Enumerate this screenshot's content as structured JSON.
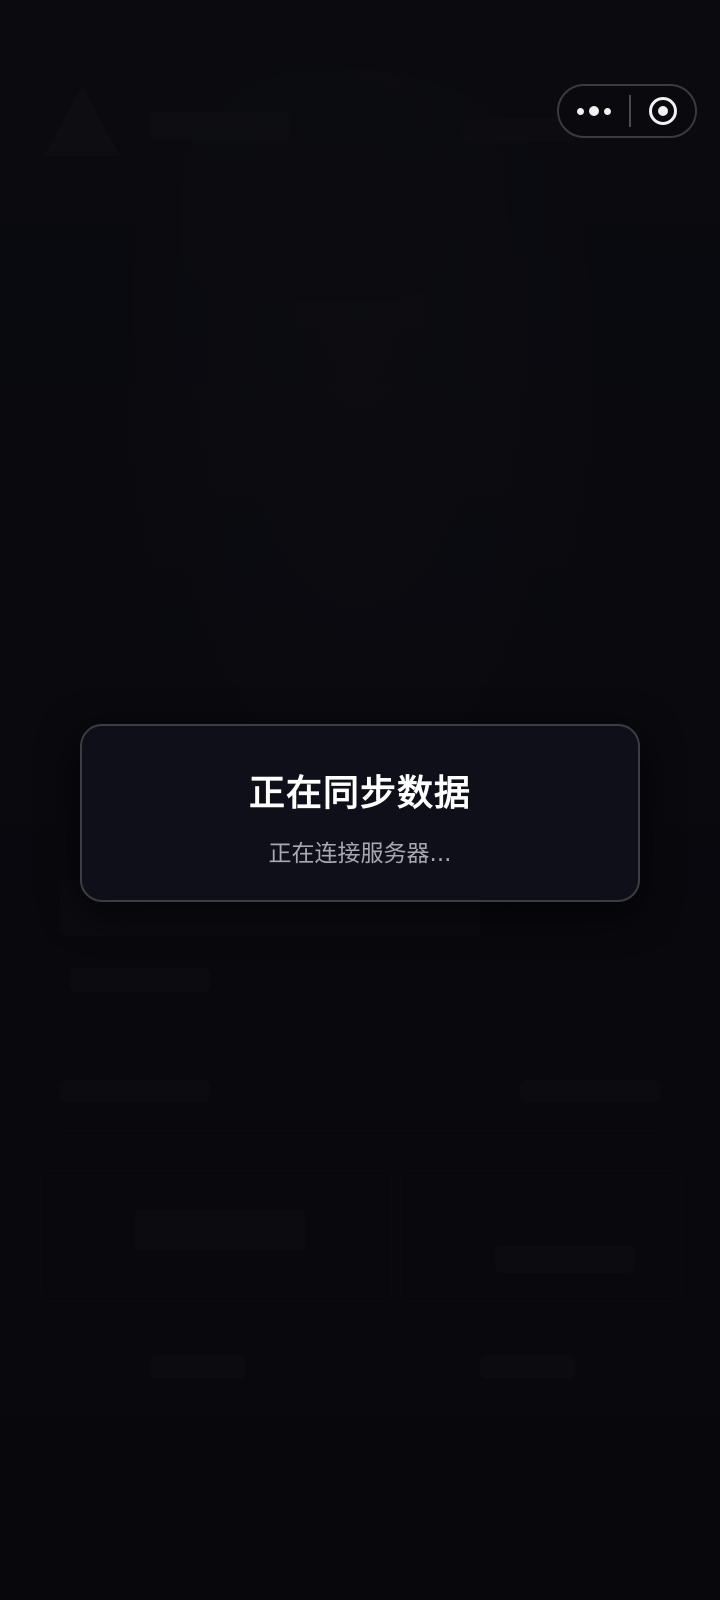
{
  "capsule": {
    "more_icon": "more-dots-icon",
    "close_icon": "target-circle-icon"
  },
  "dialog": {
    "title": "正在同步数据",
    "subtitle": "正在连接服务器..."
  }
}
